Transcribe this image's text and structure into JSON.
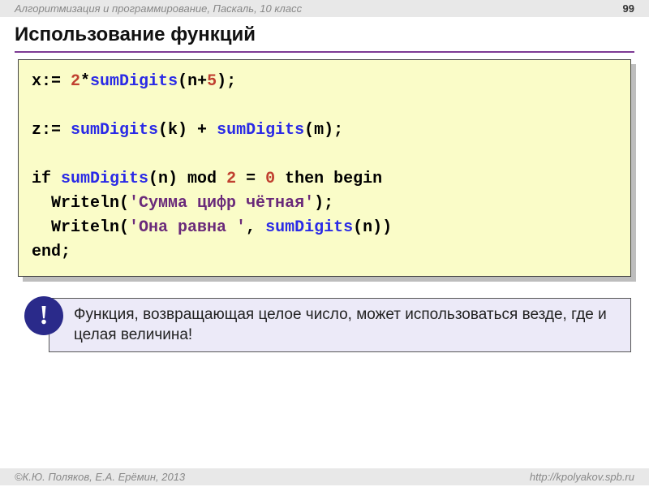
{
  "header": {
    "course": "Алгоритмизация и программирование, Паскаль, 10 класс",
    "page": "99"
  },
  "title": "Использование функций",
  "code": {
    "l1_a": "x:= ",
    "l1_b": "2",
    "l1_c": "*",
    "l1_d": "sumDigits",
    "l1_e": "(n+",
    "l1_f": "5",
    "l1_g": ");",
    "l2_a": "z:= ",
    "l2_b": "sumDigits",
    "l2_c": "(k) + ",
    "l2_d": "sumDigits",
    "l2_e": "(m);",
    "l3_a": "if ",
    "l3_b": "sumDigits",
    "l3_c": "(n) mod ",
    "l3_d": "2",
    "l3_e": " = ",
    "l3_f": "0",
    "l3_g": " then begin",
    "l4_a": "  Writeln(",
    "l4_b": "'Сумма цифр чётная'",
    "l4_c": ");",
    "l5_a": "  Writeln(",
    "l5_b": "'Она равна '",
    "l5_c": ", ",
    "l5_d": "sumDigits",
    "l5_e": "(n))",
    "l6_a": "end;"
  },
  "callout": {
    "badge": "!",
    "text": "Функция, возвращающая целое число, может использоваться везде, где и целая величина!"
  },
  "footer": {
    "authors": "К.Ю. Поляков, Е.А. Ерёмин, 2013",
    "url": "http://kpolyakov.spb.ru"
  }
}
